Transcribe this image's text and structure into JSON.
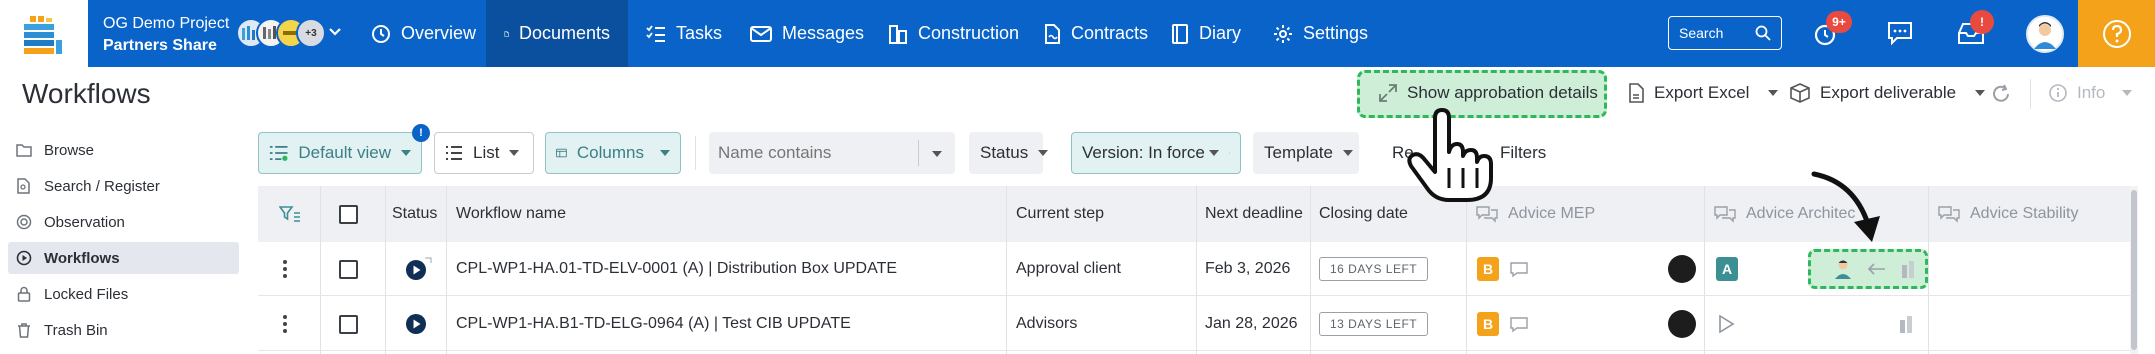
{
  "topbar": {
    "project_name": "OG Demo Project",
    "project_sub": "Partners Share",
    "avatar_more": "+3",
    "nav": [
      {
        "label": "Overview",
        "icon": "clock-icon"
      },
      {
        "label": "Documents",
        "icon": "document-icon"
      },
      {
        "label": "Tasks",
        "icon": "checklist-icon"
      },
      {
        "label": "Messages",
        "icon": "mail-icon"
      },
      {
        "label": "Construction",
        "icon": "building-icon"
      },
      {
        "label": "Contracts",
        "icon": "contract-icon"
      },
      {
        "label": "Diary",
        "icon": "book-icon"
      },
      {
        "label": "Settings",
        "icon": "gear-icon"
      }
    ],
    "search_label": "Search",
    "notif_badge": "9+",
    "inbox_badge": "!"
  },
  "header": {
    "title": "Workflows",
    "show_approbation": "Show approbation details",
    "export_excel": "Export Excel",
    "export_deliverable": "Export deliverable",
    "info": "Info"
  },
  "sidebar": {
    "items": [
      {
        "label": "Browse"
      },
      {
        "label": "Search / Register"
      },
      {
        "label": "Observation"
      },
      {
        "label": "Workflows"
      },
      {
        "label": "Locked Files"
      },
      {
        "label": "Trash Bin"
      }
    ]
  },
  "filters": {
    "view": "Default view",
    "view_badge": "!",
    "list": "List",
    "columns": "Columns",
    "name_placeholder": "Name contains",
    "status": "Status",
    "version": "Version: In force",
    "template": "Template",
    "reset_partial": "Re",
    "filters": "Filters"
  },
  "table": {
    "headers": {
      "status": "Status",
      "workflow_name": "Workflow name",
      "current_step": "Current step",
      "next_deadline": "Next deadline",
      "closing_date": "Closing date",
      "advice_mep": "Advice MEP",
      "advice_architect": "Advice Architec",
      "advice_stability": "Advice Stability"
    },
    "rows": [
      {
        "name": "CPL-WP1-HA.01-TD-ELV-0001 (A) | Distribution Box UPDATE",
        "step": "Approval client",
        "deadline": "Feb 3, 2026",
        "days_left": "16 DAYS LEFT",
        "mep_badge": "B",
        "arch_badge": "A"
      },
      {
        "name": "CPL-WP1-HA.B1-TD-ELG-0964 (A) | Test CIB UPDATE",
        "step": "Advisors",
        "deadline": "Jan 28, 2026",
        "days_left": "13 DAYS LEFT",
        "mep_badge": "B",
        "arch_badge": ""
      }
    ]
  },
  "colors": {
    "brand_blue": "#0a63c9",
    "active_nav": "#0b4f9f",
    "help_orange": "#f4a21a",
    "highlight_green": "#2eb85c",
    "teal": "#3c8f93",
    "badge_red": "#e94a3f"
  }
}
